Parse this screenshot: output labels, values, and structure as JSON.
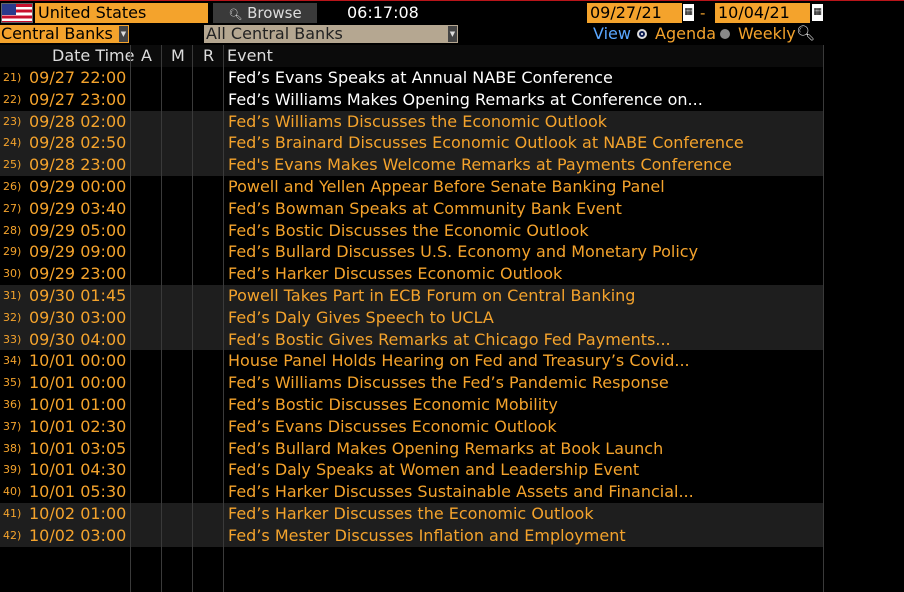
{
  "toolbar": {
    "country": "United States",
    "browse_label": "Browse",
    "browse_icon": "magnifier-icon",
    "time": "06:17:08",
    "date_from": "09/27/21",
    "date_separator": "-",
    "date_to": "10/04/21",
    "region": "Central Banks",
    "bank_filter": "All Central Banks",
    "view_label": "View",
    "view_options": [
      "Agenda",
      "Weekly"
    ],
    "view_selected": "Agenda"
  },
  "table": {
    "columns": [
      "Date Time",
      "A",
      "M",
      "R",
      "Event"
    ],
    "rows": [
      {
        "num": "21)",
        "datetime": "09/27 22:00",
        "event": "Fed’s Evans Speaks at Annual NABE Conference",
        "color": "white",
        "alt": false
      },
      {
        "num": "22)",
        "datetime": "09/27 23:00",
        "event": "Fed’s Williams Makes Opening Remarks at Conference on...",
        "color": "white",
        "alt": false
      },
      {
        "num": "23)",
        "datetime": "09/28 02:00",
        "event": "Fed’s Williams Discusses the Economic Outlook",
        "color": "orange",
        "alt": true
      },
      {
        "num": "24)",
        "datetime": "09/28 02:50",
        "event": "Fed’s Brainard Discusses Economic Outlook at NABE Conference",
        "color": "orange",
        "alt": true
      },
      {
        "num": "25)",
        "datetime": "09/28 23:00",
        "event": "Fed's Evans Makes Welcome Remarks at Payments Conference",
        "color": "orange",
        "alt": true
      },
      {
        "num": "26)",
        "datetime": "09/29 00:00",
        "event": "Powell and Yellen Appear Before Senate Banking Panel",
        "color": "orange",
        "alt": false
      },
      {
        "num": "27)",
        "datetime": "09/29 03:40",
        "event": "Fed’s Bowman Speaks at Community Bank Event",
        "color": "orange",
        "alt": false
      },
      {
        "num": "28)",
        "datetime": "09/29 05:00",
        "event": "Fed’s Bostic Discusses the Economic Outlook",
        "color": "orange",
        "alt": false
      },
      {
        "num": "29)",
        "datetime": "09/29 09:00",
        "event": "Fed’s Bullard Discusses U.S. Economy and Monetary Policy",
        "color": "orange",
        "alt": false
      },
      {
        "num": "30)",
        "datetime": "09/29 23:00",
        "event": "Fed’s Harker Discusses Economic Outlook",
        "color": "orange",
        "alt": false
      },
      {
        "num": "31)",
        "datetime": "09/30 01:45",
        "event": "Powell Takes Part in ECB Forum on Central Banking",
        "color": "orange",
        "alt": true
      },
      {
        "num": "32)",
        "datetime": "09/30 03:00",
        "event": "Fed’s Daly Gives Speech to UCLA",
        "color": "orange",
        "alt": true
      },
      {
        "num": "33)",
        "datetime": "09/30 04:00",
        "event": "Fed’s Bostic Gives Remarks at Chicago Fed Payments...",
        "color": "orange",
        "alt": true
      },
      {
        "num": "34)",
        "datetime": "10/01 00:00",
        "event": "House Panel Holds Hearing on Fed and Treasury’s Covid...",
        "color": "orange",
        "alt": false
      },
      {
        "num": "35)",
        "datetime": "10/01 00:00",
        "event": "Fed’s Williams Discusses the Fed’s Pandemic Response",
        "color": "orange",
        "alt": false
      },
      {
        "num": "36)",
        "datetime": "10/01 01:00",
        "event": "Fed’s Bostic Discusses Economic Mobility",
        "color": "orange",
        "alt": false
      },
      {
        "num": "37)",
        "datetime": "10/01 02:30",
        "event": "Fed’s Evans Discusses Economic Outlook",
        "color": "orange",
        "alt": false
      },
      {
        "num": "38)",
        "datetime": "10/01 03:05",
        "event": "Fed’s Bullard Makes Opening Remarks at Book Launch",
        "color": "orange",
        "alt": false
      },
      {
        "num": "39)",
        "datetime": "10/01 04:30",
        "event": "Fed’s Daly Speaks at Women and Leadership Event",
        "color": "orange",
        "alt": false
      },
      {
        "num": "40)",
        "datetime": "10/01 05:30",
        "event": "Fed’s Harker Discusses Sustainable Assets and Financial...",
        "color": "orange",
        "alt": false
      },
      {
        "num": "41)",
        "datetime": "10/02 01:00",
        "event": "Fed’s Harker Discusses the Economic Outlook",
        "color": "orange",
        "alt": true
      },
      {
        "num": "42)",
        "datetime": "10/02 03:00",
        "event": "Fed’s Mester Discusses Inflation and Employment",
        "color": "orange",
        "alt": true
      }
    ]
  }
}
